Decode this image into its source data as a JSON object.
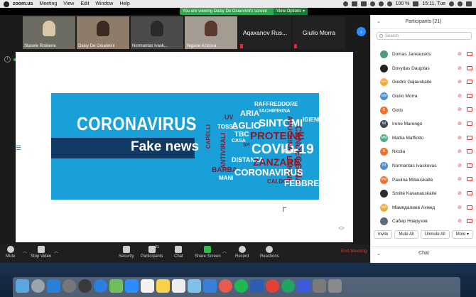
{
  "menubar": {
    "app": "zoom.us",
    "items": [
      "Meeting",
      "View",
      "Edit",
      "Window",
      "Help"
    ],
    "battery": "100 %",
    "clock": "15:11, Tue"
  },
  "share_banner": {
    "text": "You are viewing Daisy De Gioannini's screen",
    "view_options": "View Options"
  },
  "video_tiles": [
    {
      "name": "Stasele Riskiene"
    },
    {
      "name": "Daisy De Gioannini"
    },
    {
      "name": "Normantas Ivask..."
    },
    {
      "name": "Yegane Azizova"
    }
  ],
  "name_tiles": [
    "Aqaxanov Rus...",
    "Giulio Morra"
  ],
  "slide": {
    "headline": "CORONAVIRUS",
    "subheadline": "Fake news",
    "word_cloud": [
      "RAFFREDDORE",
      "TACHIPIRINA",
      "ARIA",
      "IGIENE",
      "UV",
      "AGLIO",
      "SINTOMI",
      "TOSSE",
      "CAPELLI",
      "TBC",
      "PROTEINE",
      "CANDEGGINA",
      "CASA",
      "SR",
      "COVID-19",
      "PANE",
      "ANTIVIRALI",
      "AMUCHINA",
      "DISTANZA",
      "ZANZARE",
      "LIMONI",
      "BARBA",
      "CORONAVIRUS",
      "MANI",
      "CALDO",
      "FEBBRE"
    ],
    "colors": {
      "background": "#1aa0d8",
      "box": "#103a63",
      "accent": "#8c1a2c"
    }
  },
  "toolbar": {
    "mute": "Mute",
    "stop_video": "Stop Video",
    "security": "Security",
    "participants": "Participants",
    "participants_count": "21",
    "chat": "Chat",
    "share_screen": "Share Screen",
    "record": "Record",
    "reactions": "Reactions",
    "end_meeting": "End Meeting"
  },
  "panel": {
    "title": "Participants (21)",
    "search_placeholder": "Search",
    "participants": [
      {
        "name": "Domas Jankauskis",
        "initials": "",
        "color": "#4b9d7c"
      },
      {
        "name": "Dovydas Daujotas",
        "initials": "",
        "color": "#222222"
      },
      {
        "name": "Giedrė Gajauskaitė",
        "initials": "GG",
        "color": "#f0a93b"
      },
      {
        "name": "Giulio Morra",
        "initials": "GM",
        "color": "#4a8ecf"
      },
      {
        "name": "Gotis",
        "initials": "G",
        "color": "#e8742e"
      },
      {
        "name": "Irene Marengo",
        "initials": "IM",
        "color": "#3c4a5a"
      },
      {
        "name": "Mattia Maffiotto",
        "initials": "MM",
        "color": "#4caf84"
      },
      {
        "name": "Nicola",
        "initials": "N",
        "color": "#e8742e"
      },
      {
        "name": "Normantas Ivaskovas",
        "initials": "NI",
        "color": "#4a8ecf"
      },
      {
        "name": "Paulina Miliauskaitė",
        "initials": "PM",
        "color": "#e8742e"
      },
      {
        "name": "Smiltė Kavanauskaitė",
        "initials": "",
        "color": "#2b2b2b"
      },
      {
        "name": "Мамедалиев Ахмед",
        "initials": "MA",
        "color": "#f0a93b"
      },
      {
        "name": "Сабир Новрузов",
        "initials": "",
        "color": "#5a6b7a"
      }
    ],
    "buttons": {
      "invite": "Invite",
      "mute_all": "Mute All",
      "unmute_all": "Unmute All",
      "more": "More"
    },
    "chat": "Chat"
  }
}
